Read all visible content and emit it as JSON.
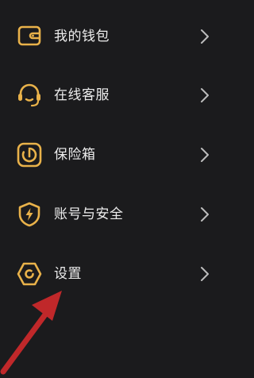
{
  "menu": {
    "items": [
      {
        "label": "我的钱包",
        "icon": "wallet-icon"
      },
      {
        "label": "在线客服",
        "icon": "headset-icon"
      },
      {
        "label": "保险箱",
        "icon": "safe-icon"
      },
      {
        "label": "账号与安全",
        "icon": "shield-lightning-icon"
      },
      {
        "label": "设置",
        "icon": "settings-icon"
      }
    ]
  },
  "colors": {
    "background": "#1b1b1d",
    "accent": "#e9b24a",
    "text": "#ededed",
    "chevron": "#bdbdbd",
    "annotation_arrow": "#c0282a"
  }
}
